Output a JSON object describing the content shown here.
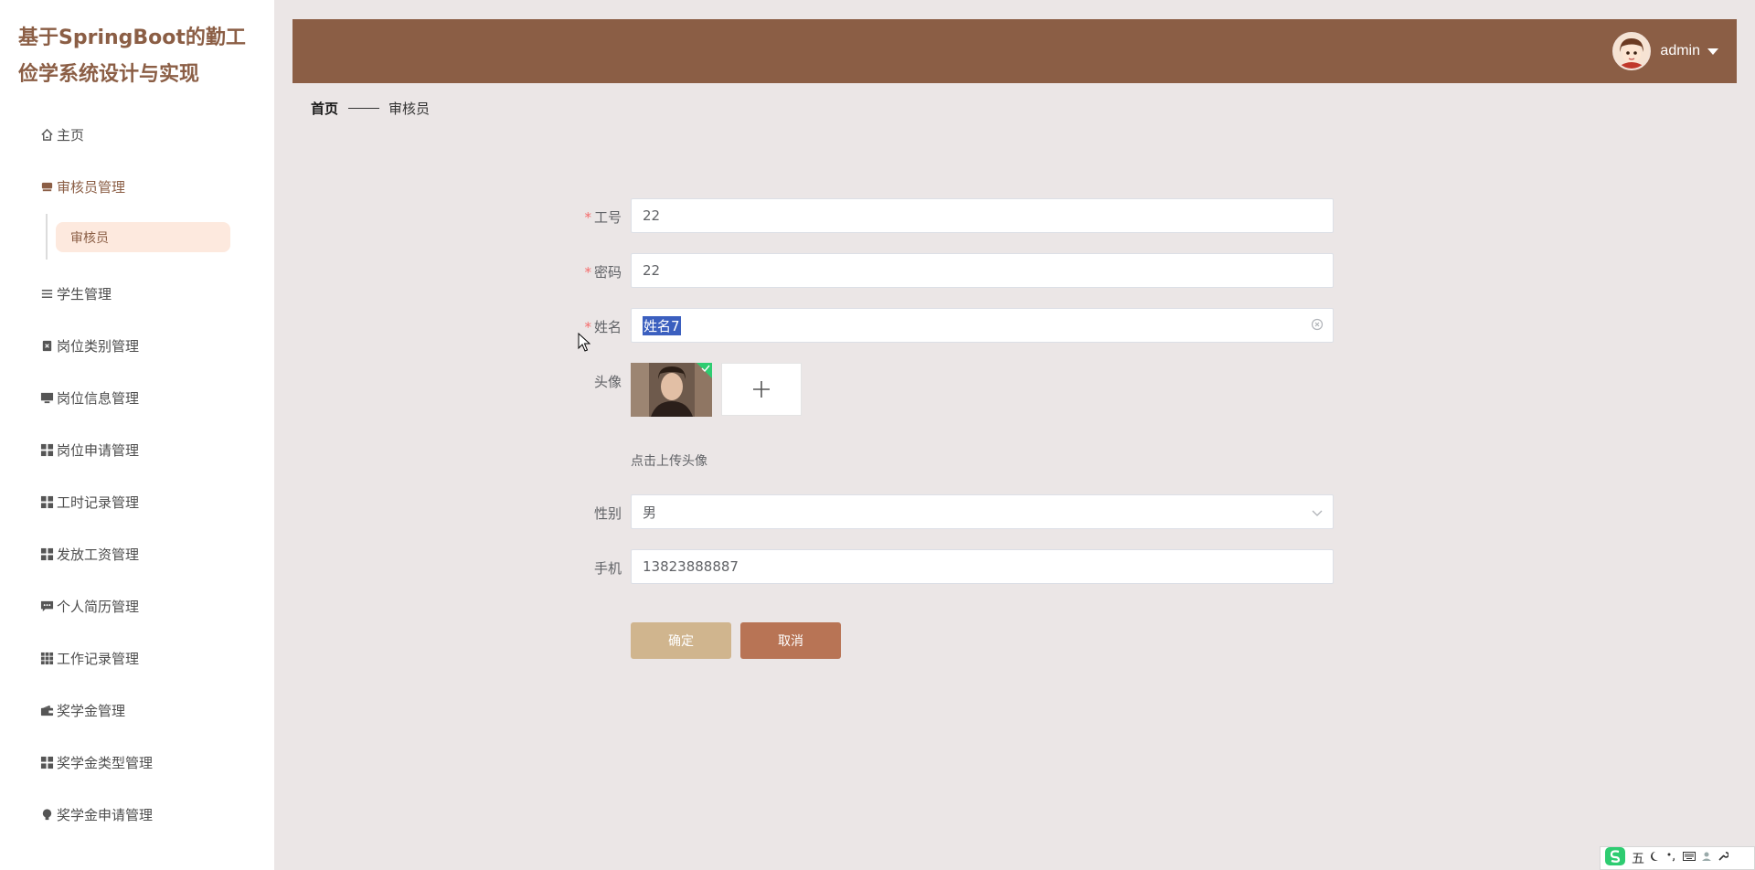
{
  "app": {
    "title": "基于SpringBoot的勤工俭学系统设计与实现"
  },
  "sidebar": {
    "items": [
      {
        "label": "主页",
        "icon": "home-icon"
      },
      {
        "label": "审核员管理",
        "icon": "user-icon",
        "active": true
      },
      {
        "label": "学生管理",
        "icon": "list-icon"
      },
      {
        "label": "岗位类别管理",
        "icon": "clipboard-icon"
      },
      {
        "label": "岗位信息管理",
        "icon": "monitor-icon"
      },
      {
        "label": "岗位申请管理",
        "icon": "grid-icon"
      },
      {
        "label": "工时记录管理",
        "icon": "grid-icon"
      },
      {
        "label": "发放工资管理",
        "icon": "grid-icon"
      },
      {
        "label": "个人简历管理",
        "icon": "message-icon"
      },
      {
        "label": "工作记录管理",
        "icon": "grid9-icon"
      },
      {
        "label": "奖学金管理",
        "icon": "wallet-icon"
      },
      {
        "label": "奖学金类型管理",
        "icon": "grid-icon"
      },
      {
        "label": "奖学金申请管理",
        "icon": "bulb-icon"
      }
    ],
    "subitem": "审核员"
  },
  "header": {
    "username": "admin"
  },
  "breadcrumb": {
    "home": "首页",
    "current": "审核员"
  },
  "form": {
    "id_label": "工号",
    "id_value": "22",
    "password_label": "密码",
    "password_value": "22",
    "name_label": "姓名",
    "name_value": "姓名7",
    "avatar_label": "头像",
    "upload_hint": "点击上传头像",
    "gender_label": "性别",
    "gender_value": "男",
    "phone_label": "手机",
    "phone_value": "13823888887",
    "ok_label": "确定",
    "cancel_label": "取消"
  },
  "ime": {
    "mode": "五"
  },
  "colors": {
    "brand": "#8b5e45",
    "header": "#8b5e45",
    "ok": "#d0b58e",
    "cancel": "#b87455",
    "highlight": "#fde9de"
  }
}
